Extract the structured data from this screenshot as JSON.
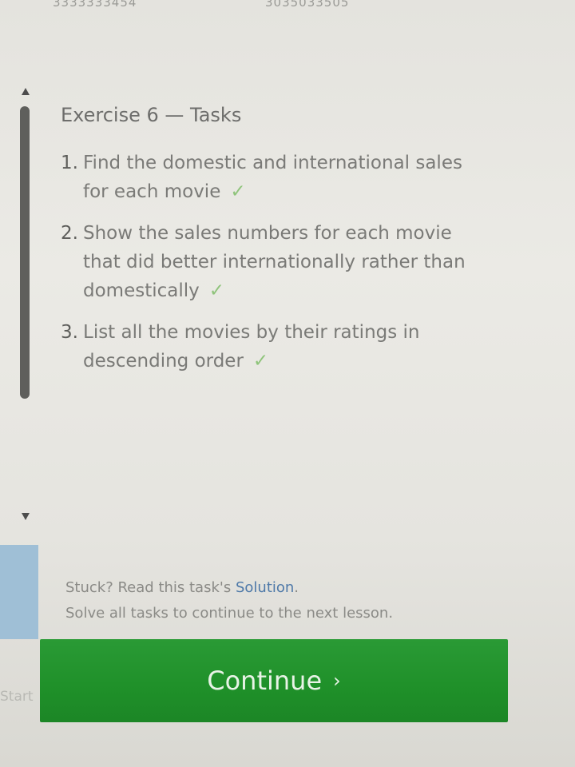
{
  "top_numbers": {
    "left": "3333333454",
    "right": "3035033505"
  },
  "exercise": {
    "title": "Exercise 6 — Tasks"
  },
  "tasks": [
    {
      "number": "1.",
      "text": "Find the domestic and international sales for each movie",
      "check": "✓"
    },
    {
      "number": "2.",
      "text": "Show the sales numbers for each movie that did better internationally rather than domestically",
      "check": "✓"
    },
    {
      "number": "3.",
      "text": "List all the movies by their ratings in descending order",
      "check": "✓"
    }
  ],
  "footer": {
    "stuck_text": "Stuck? Read this task's",
    "solution_link": "Solution",
    "solution_period": ".",
    "solve_all": "Solve all tasks to continue to the next lesson."
  },
  "continue_button": {
    "label": "Continue",
    "chevron": "›"
  },
  "left_panel": {
    "start_label": "Start"
  },
  "colors": {
    "continue_green": "#1f9029",
    "check_green": "#8fc47b",
    "link_blue": "#4e79a8",
    "left_panel_blue": "#9fbfd6"
  },
  "icons": {
    "scroll_up": "triangle-up",
    "scroll_down": "triangle-down",
    "check": "checkmark",
    "continue": "chevron-right"
  }
}
